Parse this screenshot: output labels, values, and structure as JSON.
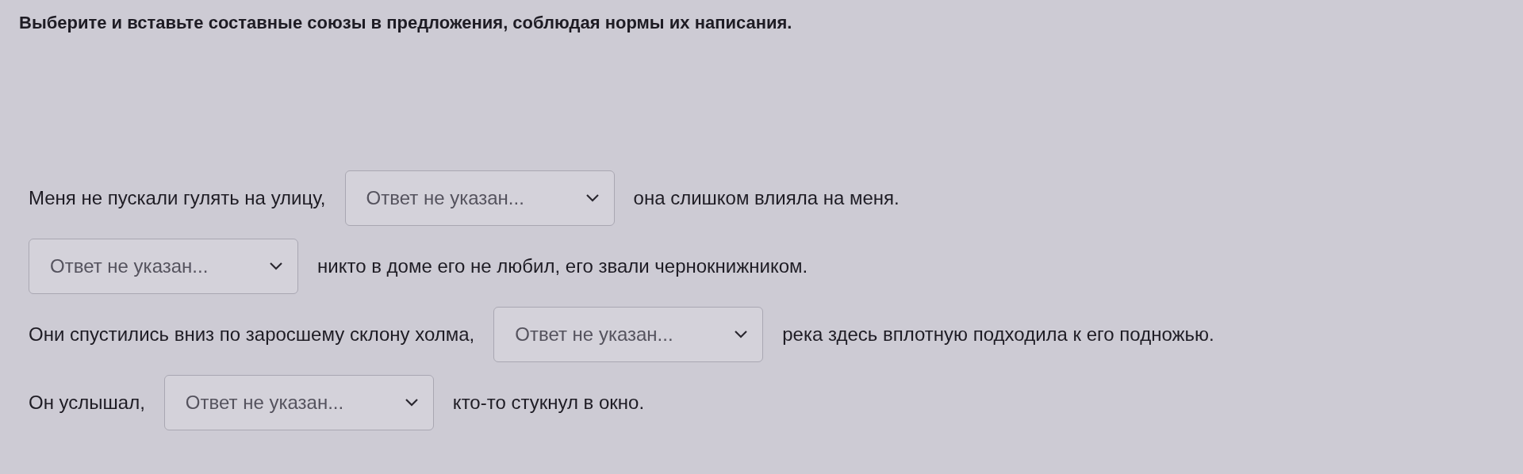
{
  "instruction": "Выберите и вставьте составные союзы в предложения, соблюдая нормы их написания.",
  "sentences": [
    {
      "parts": [
        {
          "kind": "text",
          "text": "Меня не пускали гулять на улицу,"
        },
        {
          "kind": "select",
          "value": "Ответ не указан..."
        },
        {
          "kind": "text",
          "text": "она слишком влияла на меня."
        }
      ]
    },
    {
      "parts": [
        {
          "kind": "select",
          "value": "Ответ не указан..."
        },
        {
          "kind": "text",
          "text": "никто в доме его не любил, его звали чернокнижником."
        }
      ]
    },
    {
      "parts": [
        {
          "kind": "text",
          "text": "Они спустились вниз по заросшему склону холма,"
        },
        {
          "kind": "select",
          "value": "Ответ не указан..."
        },
        {
          "kind": "text",
          "text": "река здесь вплотную подходила к его подножью."
        }
      ]
    },
    {
      "parts": [
        {
          "kind": "text",
          "text": "Он услышал,"
        },
        {
          "kind": "select",
          "value": "Ответ не указан..."
        },
        {
          "kind": "text",
          "text": "кто-то стукнул в окно."
        }
      ]
    }
  ]
}
